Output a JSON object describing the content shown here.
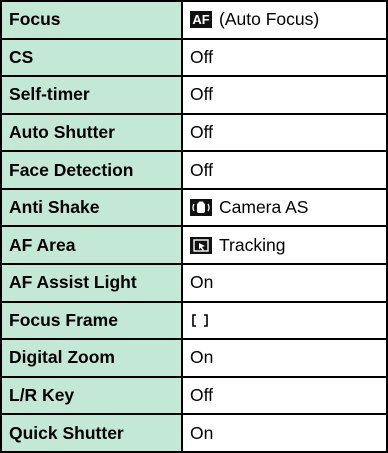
{
  "colors": {
    "label_background": "#c3e8d6",
    "value_background": "#ffffff",
    "border": "#000000"
  },
  "rows": [
    {
      "label": "Focus",
      "value": "(Auto Focus)",
      "icon": "af-icon"
    },
    {
      "label": "CS",
      "value": "Off"
    },
    {
      "label": "Self-timer",
      "value": "Off"
    },
    {
      "label": "Auto Shutter",
      "value": "Off"
    },
    {
      "label": "Face Detection",
      "value": "Off"
    },
    {
      "label": "Anti Shake",
      "value": "Camera AS",
      "icon": "camera-shake-icon"
    },
    {
      "label": "AF Area",
      "value": "Tracking",
      "icon": "tracking-icon"
    },
    {
      "label": "AF Assist Light",
      "value": "On"
    },
    {
      "label": "Focus Frame",
      "value": "",
      "icon": "focus-frame-brackets-icon"
    },
    {
      "label": "Digital Zoom",
      "value": "On"
    },
    {
      "label": "L/R Key",
      "value": "Off"
    },
    {
      "label": "Quick Shutter",
      "value": "On"
    }
  ]
}
